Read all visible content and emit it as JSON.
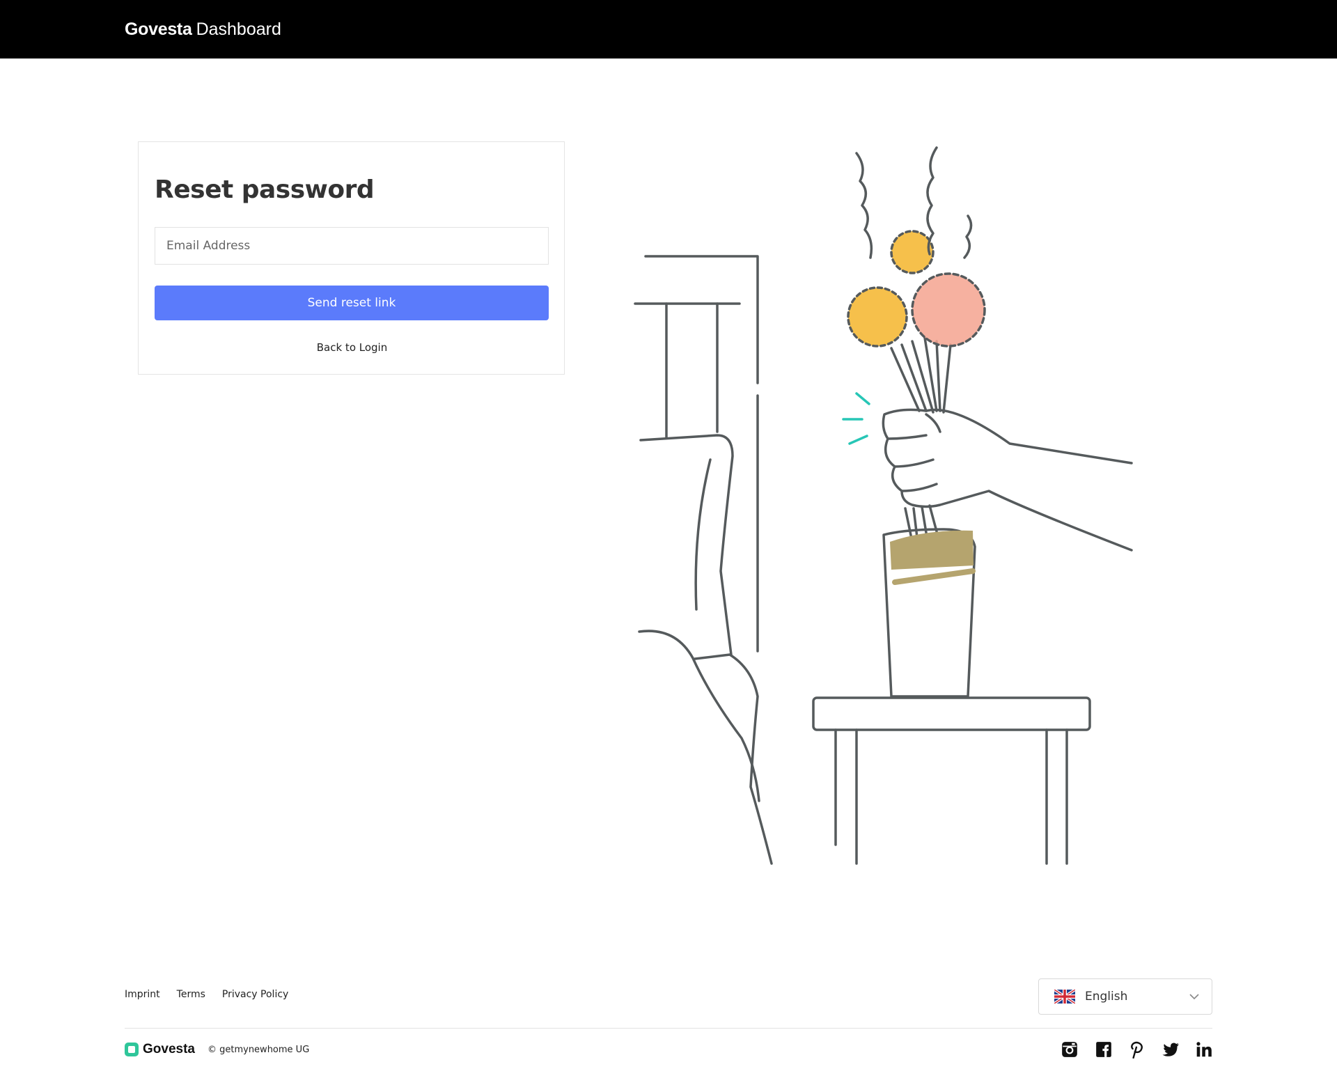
{
  "header": {
    "brand_bold": "Govesta",
    "brand_light": "Dashboard"
  },
  "form": {
    "title": "Reset password",
    "email_placeholder": "Email Address",
    "email_value": "",
    "submit_label": "Send reset link",
    "back_label": "Back to Login"
  },
  "footer": {
    "links": [
      "Imprint",
      "Terms",
      "Privacy Policy"
    ],
    "language": {
      "flag": "uk-flag-icon",
      "label": "English"
    },
    "brand": "Govesta",
    "copyright": "© getmynewhome UG",
    "social": [
      "instagram-icon",
      "facebook-icon",
      "pinterest-icon",
      "twitter-icon",
      "linkedin-icon"
    ]
  },
  "colors": {
    "topbar": "#000000",
    "primary_button": "#5b7bfb",
    "brand_green": "#2fc69a",
    "vase_band": "#b5a46e",
    "flower_yellow": "#f5b52c",
    "flower_pink": "#f4a38f",
    "accent_teal": "#27c6b6"
  }
}
